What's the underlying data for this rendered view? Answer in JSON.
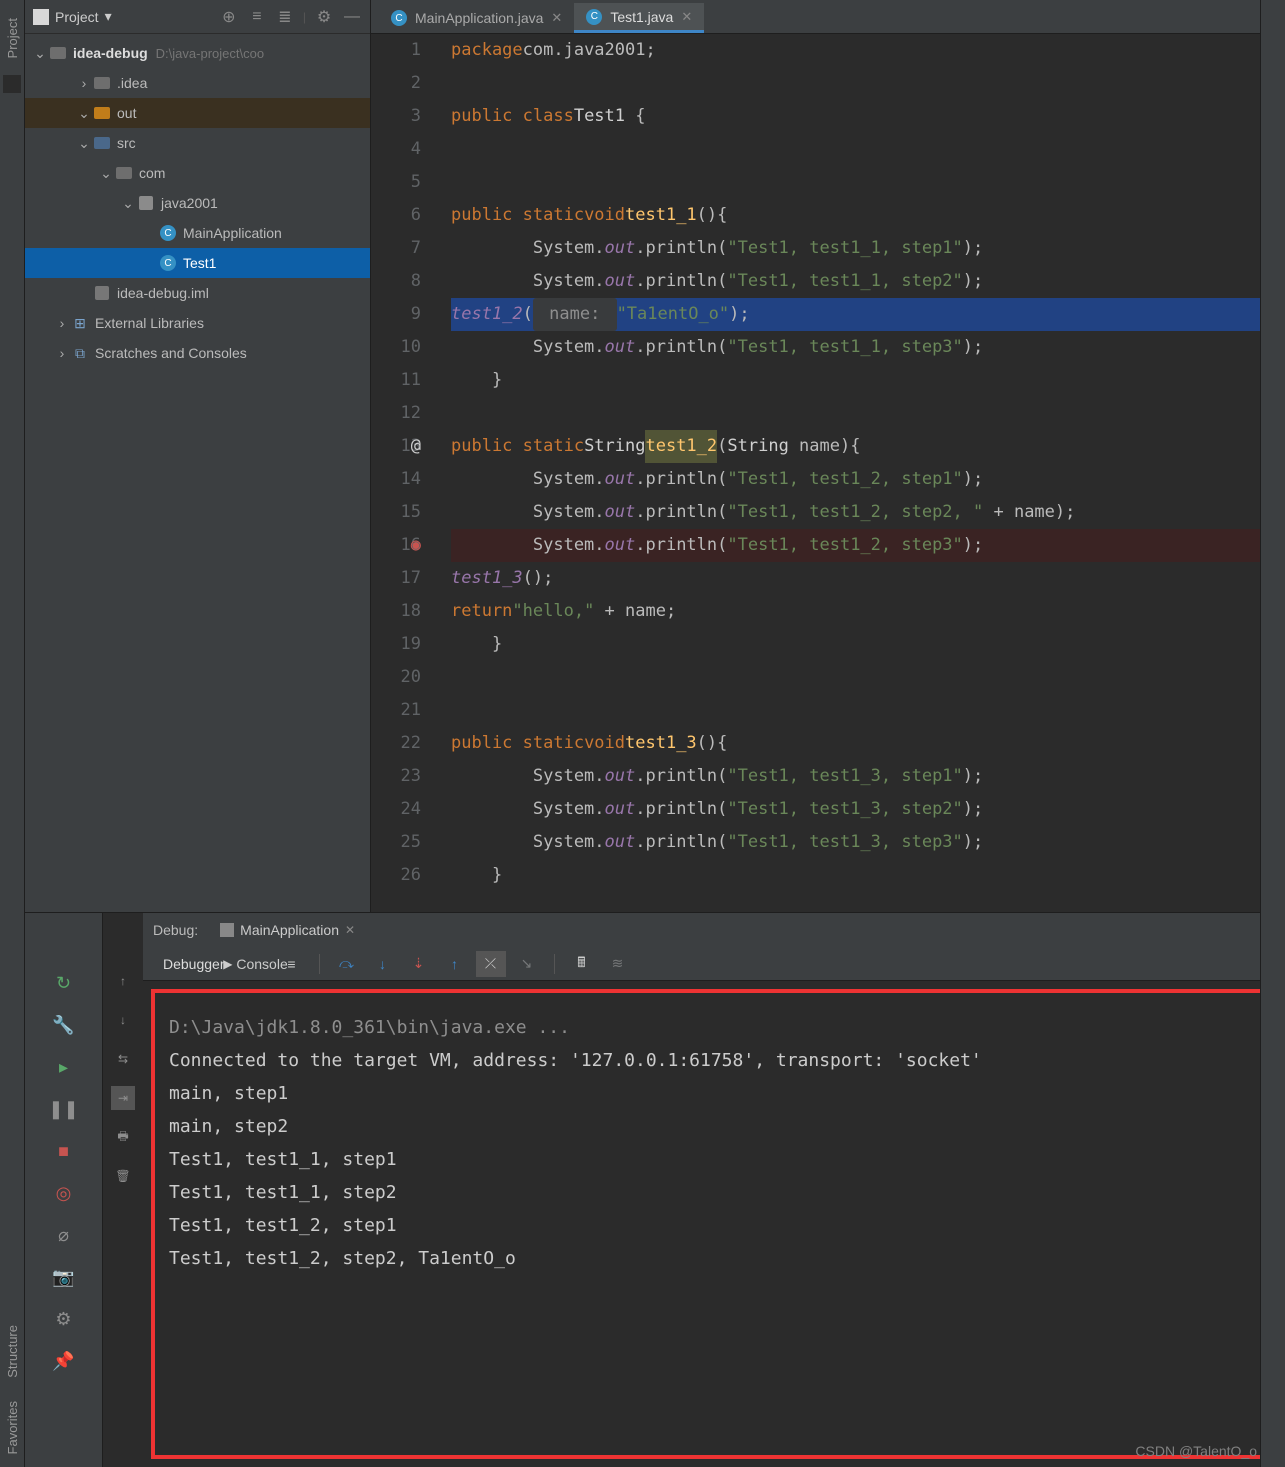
{
  "sidebar": {
    "title": "Project",
    "root": {
      "name": "idea-debug",
      "path": "D:\\java-project\\coo"
    },
    "tree": [
      {
        "name": ".idea",
        "depth": 2,
        "kind": "folder",
        "twist": "›"
      },
      {
        "name": "out",
        "depth": 2,
        "kind": "folder-orange",
        "twist": "⌄",
        "sel": "out"
      },
      {
        "name": "src",
        "depth": 2,
        "kind": "folder-blue",
        "twist": "⌄"
      },
      {
        "name": "com",
        "depth": 3,
        "kind": "folder",
        "twist": "⌄"
      },
      {
        "name": "java2001",
        "depth": 4,
        "kind": "pkg",
        "twist": "⌄"
      },
      {
        "name": "MainApplication",
        "depth": 5,
        "kind": "class",
        "twist": ""
      },
      {
        "name": "Test1",
        "depth": 5,
        "kind": "class",
        "twist": "",
        "sel": "sel"
      },
      {
        "name": "idea-debug.iml",
        "depth": 2,
        "kind": "file",
        "twist": ""
      },
      {
        "name": "External Libraries",
        "depth": 1,
        "kind": "lib",
        "twist": "›"
      },
      {
        "name": "Scratches and Consoles",
        "depth": 1,
        "kind": "scratch",
        "twist": "›"
      }
    ]
  },
  "tabs": [
    {
      "name": "MainApplication.java",
      "active": false
    },
    {
      "name": "Test1.java",
      "active": true
    }
  ],
  "code_lines": [
    {
      "n": 1,
      "raw": "package com.java2001;",
      "kind": "pkg"
    },
    {
      "n": 2,
      "raw": ""
    },
    {
      "n": 3,
      "raw": "public class Test1 {",
      "kind": "cls"
    },
    {
      "n": 4,
      "raw": ""
    },
    {
      "n": 5,
      "raw": ""
    },
    {
      "n": 6,
      "raw": "    public static void test1_1(){",
      "kind": "mth"
    },
    {
      "n": 7,
      "raw": "        System.out.println(\"Test1, test1_1, step1\");",
      "kind": "print"
    },
    {
      "n": 8,
      "raw": "        System.out.println(\"Test1, test1_1, step2\");",
      "kind": "print"
    },
    {
      "n": 9,
      "raw": "        test1_2( name: \"Ta1entO_o\");",
      "kind": "cur"
    },
    {
      "n": 10,
      "raw": "        System.out.println(\"Test1, test1_1, step3\");",
      "kind": "print"
    },
    {
      "n": 11,
      "raw": "    }"
    },
    {
      "n": 12,
      "raw": ""
    },
    {
      "n": 13,
      "raw": "    public static String test1_2(String name){",
      "kind": "mth2",
      "anno": "@"
    },
    {
      "n": 14,
      "raw": "        System.out.println(\"Test1, test1_2, step1\");",
      "kind": "print"
    },
    {
      "n": 15,
      "raw": "        System.out.println(\"Test1, test1_2, step2, \" + name);",
      "kind": "print2"
    },
    {
      "n": 16,
      "raw": "        System.out.println(\"Test1, test1_2, step3\");",
      "kind": "print",
      "brk": true
    },
    {
      "n": 17,
      "raw": "        test1_3();",
      "kind": "call"
    },
    {
      "n": 18,
      "raw": "        return \"hello,\" + name;",
      "kind": "ret"
    },
    {
      "n": 19,
      "raw": "    }"
    },
    {
      "n": 20,
      "raw": ""
    },
    {
      "n": 21,
      "raw": ""
    },
    {
      "n": 22,
      "raw": "    public static void test1_3(){",
      "kind": "mth"
    },
    {
      "n": 23,
      "raw": "        System.out.println(\"Test1, test1_3, step1\");",
      "kind": "print"
    },
    {
      "n": 24,
      "raw": "        System.out.println(\"Test1, test1_3, step2\");",
      "kind": "print"
    },
    {
      "n": 25,
      "raw": "        System.out.println(\"Test1, test1_3, step3\");",
      "kind": "print"
    },
    {
      "n": 26,
      "raw": "    }"
    }
  ],
  "debug": {
    "panel_label": "Debug:",
    "run_tab": "MainApplication",
    "tool_labels": {
      "debugger": "Debugger",
      "console": "Console"
    },
    "console_lines": [
      "D:\\Java\\jdk1.8.0_361\\bin\\java.exe ...",
      "Connected to the target VM, address: '127.0.0.1:61758', transport: 'socket'",
      "main, step1",
      "main, step2",
      "Test1, test1_1, step1",
      "Test1, test1_1, step2",
      "Test1, test1_2, step1",
      "Test1, test1_2, step2, Ta1entO_o"
    ]
  },
  "left_strip": {
    "project": "Project",
    "structure": "Structure",
    "favorites": "Favorites"
  },
  "watermark": "CSDN @TalentO_o"
}
